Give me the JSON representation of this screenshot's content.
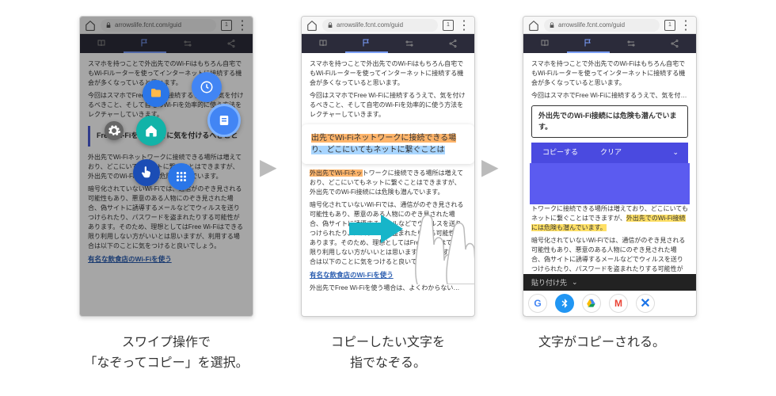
{
  "url": "arrowslife.fcnt.com/guid",
  "tab_count": "1",
  "article": {
    "p1": "スマホを持つことで外出先でのWi-Fiはもちろん自宅でもWi-Fiルーターを使ってインターネットに接続する機会が多くなっていると思います。",
    "p2": "今回はスマホでFree Wi-Fiに接続するうえで、気を付けるべきこと、そして自宅のWi-Fiを効率的に使う方法をレクチャーしていきます。",
    "callout": "Free Wi-Fiを使うときに気を付けるべきこと",
    "highlight_a": "出先でWi-Fiネットワークに接続できる場",
    "highlight_b": "り、どこにいてもネットに繋ぐことは",
    "p3a": "外出先でWi-Fiネッ",
    "p3b": "トワークに接続できる場所は増えており、どこにいてもネットに繋ぐことはできますが、",
    "p3c": "外出先でのWi-Fi接続には危険も潜んでいます。",
    "p4": "暗号化されていないWi-Fiでは、通信がのぞき見される可能性もあり、悪意のある人物にのぞき見された場合、偽サイトに誘導するメールなどでウィルスを送りつけられたり、パスワードを盗まれたりする可能性があります。そのため、理想としてはFree Wi-Fiはできる限り利用しない方がいいとは思いますが、利用する場合は以下のことに気をつけると良いでしょう。",
    "link1": "有名な飲食店のWi-Fiを使う",
    "p5": "外出先でFree Wi-Fiを使う場合は、よくわからない…"
  },
  "copied_text": "外出先でのWi-Fi接続には危険も潜んでいます。",
  "copybar": {
    "copy": "コピーする",
    "clear": "クリア"
  },
  "paste_label": "貼り付け先",
  "captions": {
    "c1a": "スワイプ操作で",
    "c1b": "「なぞってコピー」を選択。",
    "c2a": "コピーしたい文字を",
    "c2b": "指でなぞる。",
    "c3": "文字がコピーされる。"
  },
  "icons": {
    "clock": "clock-icon",
    "file": "file-icon",
    "note": "note-icon",
    "home": "home-icon",
    "gear": "gear-icon",
    "hand": "hand-pointer-icon",
    "grid": "apps-grid-icon",
    "google": "G",
    "bluetooth": "bt",
    "drive": "drive",
    "gmail": "M"
  }
}
